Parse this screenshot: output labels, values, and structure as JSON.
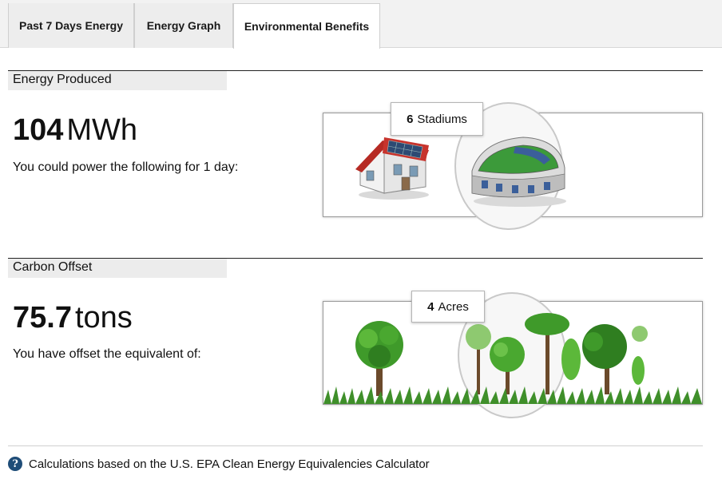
{
  "tabs": [
    {
      "label": "Past 7 Days Energy"
    },
    {
      "label": "Energy Graph"
    },
    {
      "label": "Environmental Benefits"
    }
  ],
  "energy": {
    "header": "Energy Produced",
    "value": "104",
    "unit": "MWh",
    "description": "You could power the following for 1 day:",
    "callout_count": "6",
    "callout_label": "Stadiums",
    "icons": [
      "solar-house-icon",
      "stadium-icon"
    ]
  },
  "carbon": {
    "header": "Carbon Offset",
    "value": "75.7",
    "unit": "tons",
    "description": "You have offset the equivalent of:",
    "callout_count": "4",
    "callout_label": "Acres",
    "icons": [
      "tree-icon",
      "forest-icon"
    ]
  },
  "footer": {
    "text": "Calculations based on the U.S. EPA Clean Energy Equivalencies Calculator",
    "icon": "info-icon"
  },
  "colors": {
    "section_label_bg": "#ececec",
    "info_icon": "#1f4d78",
    "tree_green": "#3f9a2a",
    "roof_red": "#c0302a"
  }
}
